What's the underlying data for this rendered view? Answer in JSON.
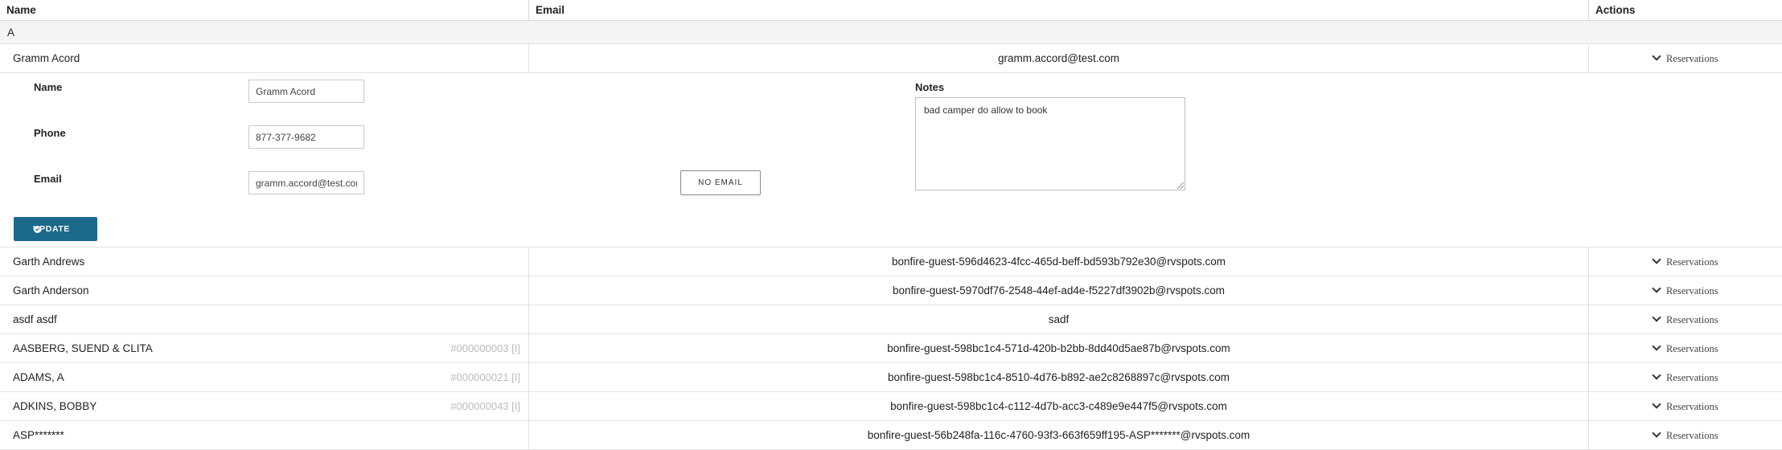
{
  "columns": {
    "name": "Name",
    "email": "Email",
    "actions": "Actions"
  },
  "group_label": "A",
  "reservations_label": "Reservations",
  "expanded_row": {
    "name": "Gramm Acord",
    "email": "gramm.accord@test.com",
    "form": {
      "name_label": "Name",
      "name_value": "Gramm Acord",
      "phone_label": "Phone",
      "phone_value": "877-377-9682",
      "email_label": "Email",
      "email_value": "gramm.accord@test.com",
      "no_email_label": "NO EMAIL",
      "notes_label": "Notes",
      "notes_value": "bad camper do allow to book",
      "update_label": "UPDATE"
    }
  },
  "rows": [
    {
      "name": "Garth Andrews",
      "id": "",
      "email": "bonfire-guest-596d4623-4fcc-465d-beff-bd593b792e30@rvspots.com"
    },
    {
      "name": "Garth Anderson",
      "id": "",
      "email": "bonfire-guest-5970df76-2548-44ef-ad4e-f5227df3902b@rvspots.com"
    },
    {
      "name": "asdf asdf",
      "id": "",
      "email": "sadf"
    },
    {
      "name": "AASBERG, SUEND & CLITA",
      "id": "#000000003 [I]",
      "email": "bonfire-guest-598bc1c4-571d-420b-b2bb-8dd40d5ae87b@rvspots.com"
    },
    {
      "name": "ADAMS, A",
      "id": "#000000021 [I]",
      "email": "bonfire-guest-598bc1c4-8510-4d76-b892-ae2c8268897c@rvspots.com"
    },
    {
      "name": "ADKINS, BOBBY",
      "id": "#000000043 [I]",
      "email": "bonfire-guest-598bc1c4-c112-4d7b-acc3-c489e9e447f5@rvspots.com"
    },
    {
      "name": "ASP*******",
      "id": "",
      "email": "bonfire-guest-56b248fa-116c-4760-93f3-663f659ff195-ASP*******@rvspots.com"
    }
  ],
  "colors": {
    "update_button": "#1b6a8c",
    "group_bg": "#f4f4f4",
    "id_tag": "#bbbbbb"
  }
}
